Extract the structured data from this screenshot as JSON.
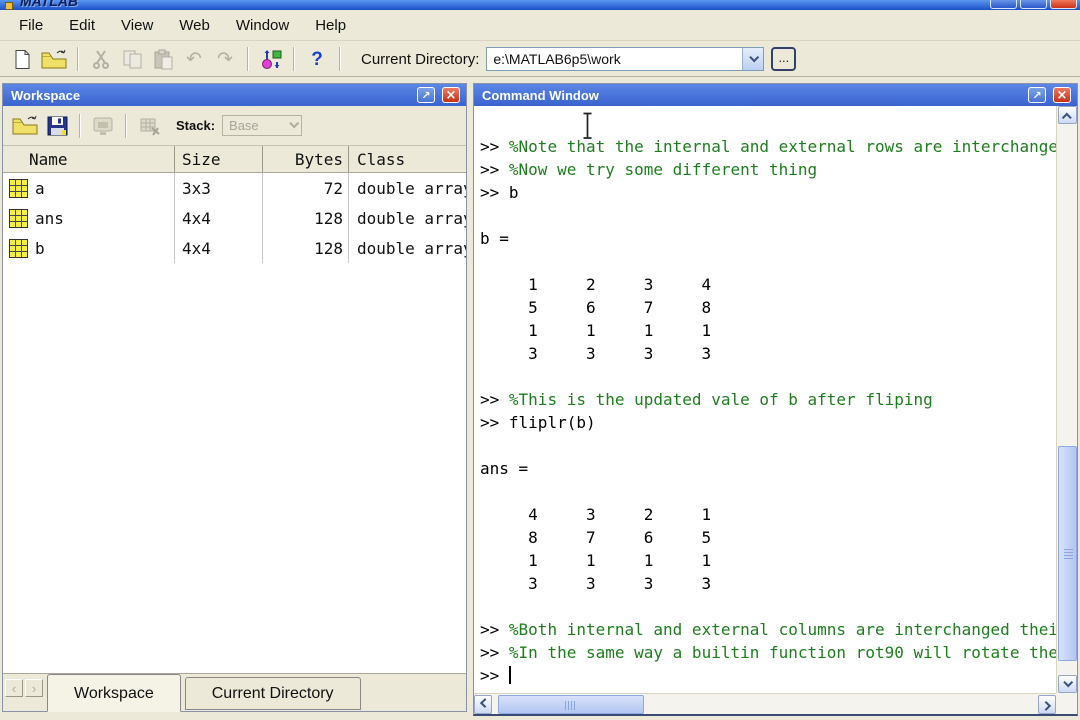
{
  "window": {
    "title": "MATLAB",
    "controls": {
      "minimize": "minimize-button",
      "maximize": "maximize-button",
      "close": "close-button"
    }
  },
  "menubar": {
    "items": [
      "File",
      "Edit",
      "View",
      "Web",
      "Window",
      "Help"
    ]
  },
  "toolbar": {
    "icons": [
      "new-document-icon",
      "open-folder-icon",
      "cut-icon",
      "copy-icon",
      "paste-icon",
      "undo-icon",
      "redo-icon",
      "simulink-icon",
      "help-icon"
    ],
    "undo_glyph": "↶",
    "redo_glyph": "↷",
    "help_glyph": "?",
    "current_directory_label": "Current Directory:",
    "current_directory_value": "e:\\MATLAB6p5\\work",
    "browse_button": "..."
  },
  "workspace_panel": {
    "title": "Workspace",
    "toolbar_icons": [
      "open-folder-icon",
      "save-icon",
      "plot-variable-icon",
      "delete-variable-icon"
    ],
    "stack_label": "Stack:",
    "stack_value": "Base",
    "table": {
      "columns": [
        "Name",
        "Size",
        "Bytes",
        "Class"
      ],
      "rows": [
        {
          "name": "a",
          "size": "3x3",
          "bytes": "72",
          "class": "double array"
        },
        {
          "name": "ans",
          "size": "4x4",
          "bytes": "128",
          "class": "double array"
        },
        {
          "name": "b",
          "size": "4x4",
          "bytes": "128",
          "class": "double array"
        }
      ]
    },
    "tabs": [
      {
        "label": "Workspace",
        "active": true
      },
      {
        "label": "Current Directory",
        "active": false
      }
    ]
  },
  "command_window": {
    "title": "Command Window",
    "prompt": ">>",
    "lines": [
      {
        "type": "blank"
      },
      {
        "type": "comment",
        "text": "%Note that the internal and external rows are interchanged"
      },
      {
        "type": "comment",
        "text": "%Now we try some different thing"
      },
      {
        "type": "command",
        "text": "b"
      },
      {
        "type": "blank"
      },
      {
        "type": "output",
        "text": "b ="
      },
      {
        "type": "blank"
      },
      {
        "type": "output",
        "text": "     1     2     3     4"
      },
      {
        "type": "output",
        "text": "     5     6     7     8"
      },
      {
        "type": "output",
        "text": "     1     1     1     1"
      },
      {
        "type": "output",
        "text": "     3     3     3     3"
      },
      {
        "type": "blank"
      },
      {
        "type": "comment",
        "text": "%This is the updated vale of b after fliping"
      },
      {
        "type": "command",
        "text": "fliplr(b)"
      },
      {
        "type": "blank"
      },
      {
        "type": "output",
        "text": "ans ="
      },
      {
        "type": "blank"
      },
      {
        "type": "output",
        "text": "     4     3     2     1"
      },
      {
        "type": "output",
        "text": "     8     7     6     5"
      },
      {
        "type": "output",
        "text": "     1     1     1     1"
      },
      {
        "type": "output",
        "text": "     3     3     3     3"
      },
      {
        "type": "blank"
      },
      {
        "type": "comment",
        "text": "%Both internal and external columns are interchanged their"
      },
      {
        "type": "comment",
        "text": "%In the same way a builtin function rot90 will rotate the"
      },
      {
        "type": "command",
        "text": "",
        "cursor": true
      }
    ]
  },
  "colors": {
    "desktop_bg": "#ece9d8",
    "panel_title_blue": "#4a74d8",
    "comment_green": "#1e7d1e",
    "variable_icon_yellow": "#f5ef41",
    "close_button_red": "#cc3218"
  }
}
